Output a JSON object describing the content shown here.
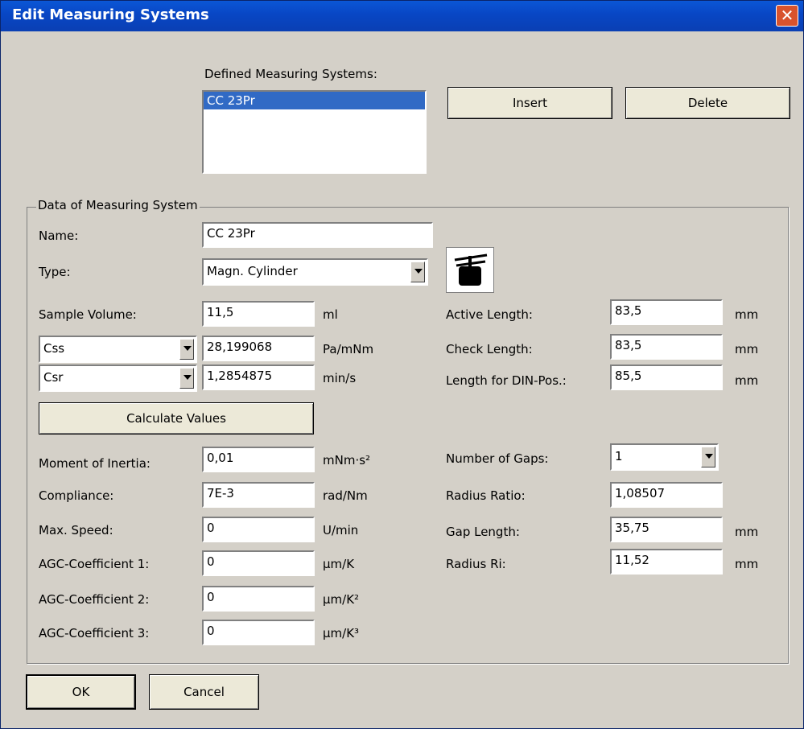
{
  "window": {
    "title": "Edit Measuring Systems",
    "close_glyph": "✕"
  },
  "systems": {
    "label": "Defined Measuring Systems:",
    "items": [
      "CC 23Pr"
    ]
  },
  "buttons": {
    "insert": "Insert",
    "delete": "Delete",
    "calculate": "Calculate Values",
    "ok": "OK",
    "cancel": "Cancel"
  },
  "group": {
    "title": "Data of Measuring System"
  },
  "fields": {
    "name_label": "Name:",
    "name_value": "CC 23Pr",
    "type_label": "Type:",
    "type_value": "Magn. Cylinder",
    "sample_volume_label": "Sample Volume:",
    "sample_volume_value": "11,5",
    "sample_volume_unit": "ml",
    "css_select": "Css",
    "css_value": "28,199068",
    "css_unit": "Pa/mNm",
    "csr_select": "Csr",
    "csr_value": "1,2854875",
    "csr_unit": "min/s",
    "moment_label": "Moment of Inertia:",
    "moment_value": "0,01",
    "moment_unit": "mNm·s²",
    "compliance_label": "Compliance:",
    "compliance_value": "7E-3",
    "compliance_unit": "rad/Nm",
    "max_speed_label": "Max. Speed:",
    "max_speed_value": "0",
    "max_speed_unit": "U/min",
    "agc1_label": "AGC-Coefficient 1:",
    "agc1_value": "0",
    "agc1_unit": "µm/K",
    "agc2_label": "AGC-Coefficient 2:",
    "agc2_value": "0",
    "agc2_unit": "µm/K²",
    "agc3_label": "AGC-Coefficient 3:",
    "agc3_value": "0",
    "agc3_unit": "µm/K³",
    "active_length_label": "Active Length:",
    "active_length_value": "83,5",
    "active_length_unit": "mm",
    "check_length_label": "Check Length:",
    "check_length_value": "83,5",
    "check_length_unit": "mm",
    "din_label": "Length for DIN-Pos.:",
    "din_value": "85,5",
    "din_unit": "mm",
    "gaps_label": "Number of Gaps:",
    "gaps_value": "1",
    "radius_ratio_label": "Radius Ratio:",
    "radius_ratio_value": "1,08507",
    "gap_length_label": "Gap Length:",
    "gap_length_value": "35,75",
    "gap_length_unit": "mm",
    "radius_ri_label": "Radius Ri:",
    "radius_ri_value": "11,52",
    "radius_ri_unit": "mm"
  },
  "icons": {
    "type_icon": "cylinder-geometry-icon"
  },
  "colors": {
    "titlebar": "#0846c4",
    "selection": "#316ac5",
    "dialog": "#d4d0c8",
    "close": "#d8532d"
  }
}
